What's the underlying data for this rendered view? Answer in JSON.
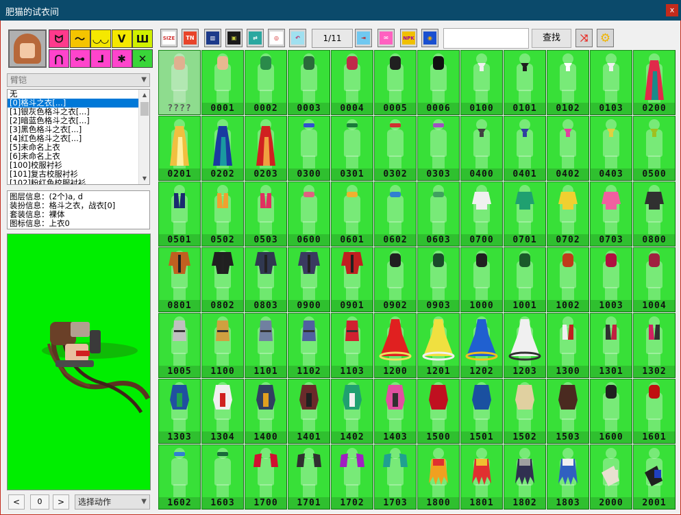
{
  "window": {
    "title": "肥猫的试衣间",
    "close": "x"
  },
  "categories": [
    {
      "icon": "cat-face-icon",
      "glyph": "ᗢ",
      "color": "#ff3a8c"
    },
    {
      "icon": "headband-icon",
      "glyph": "〜",
      "color": "#f5c400"
    },
    {
      "icon": "goggles-icon",
      "glyph": "◡◡",
      "color": "#f5e800"
    },
    {
      "icon": "wings-icon",
      "glyph": "ᐯ",
      "color": "#f5e800"
    },
    {
      "icon": "armor-icon",
      "glyph": "Ш",
      "color": "#d0f000"
    },
    {
      "icon": "pants-icon",
      "glyph": "⋂",
      "color": "#ff44cc"
    },
    {
      "icon": "belt-icon",
      "glyph": "⊶",
      "color": "#ff44cc"
    },
    {
      "icon": "boots-icon",
      "glyph": "⅃",
      "color": "#ff44cc"
    },
    {
      "icon": "figure-icon",
      "glyph": "✱",
      "color": "#ff44cc"
    },
    {
      "icon": "weapon-icon",
      "glyph": "✕",
      "color": "#39d639"
    }
  ],
  "slot_select": "臂铠",
  "list": [
    "无",
    "[0]格斗之衣[...]",
    "[1]银灰色格斗之衣[...]",
    "[2]暗蓝色格斗之衣[...]",
    "[3]黑色格斗之衣[...]",
    "[4]红色格斗之衣[...]",
    "[5]未命名上衣",
    "[6]未命名上衣",
    "[100]校服衬衫",
    "[101]复古校服衬衫",
    "[102]粉红色校服衬衫"
  ],
  "selected_index": 1,
  "info": {
    "layer": "图层信息：(2个)a, d",
    "outfit": "装扮信息：格斗之衣，战衣[0]",
    "set": "套装信息：裸体",
    "icon": "图标信息：上衣0"
  },
  "preview_nav": {
    "prev": "<",
    "frame": "0",
    "next": ">",
    "action_select": "选择动作"
  },
  "toolbar": {
    "tools": [
      {
        "name": "size-tool-icon",
        "text": "SIZE",
        "bg": "#ffffff",
        "fg": "#d03030"
      },
      {
        "name": "tn-tool-icon",
        "text": "TN",
        "bg": "#e8442a",
        "fg": "#ffffff"
      },
      {
        "name": "book-tool-icon",
        "text": "▥",
        "bg": "#1c3a8a",
        "fg": "#ffffff"
      },
      {
        "name": "frame-tool-icon",
        "text": "▣",
        "bg": "#1a1a1a",
        "fg": "#c8d040"
      },
      {
        "name": "shirt-swap-icon",
        "text": "⇄",
        "bg": "#2aa8a0",
        "fg": "#ffffff"
      },
      {
        "name": "target-tool-icon",
        "text": "◎",
        "bg": "#ffffff",
        "fg": "#d02020"
      },
      {
        "name": "undo-tool-icon",
        "text": "↶",
        "bg": "#a0e0f0",
        "fg": "#c02060"
      },
      {
        "name": "export-tool-icon",
        "text": "⇥",
        "bg": "#70c8f0",
        "fg": "#c02020"
      },
      {
        "name": "gift-tool-icon",
        "text": "✉",
        "bg": "#ff60c0",
        "fg": "#ffffff"
      },
      {
        "name": "npk-tool-icon",
        "text": "NPK",
        "bg": "#f0c000",
        "fg": "#a000a0"
      },
      {
        "name": "globe-tool-icon",
        "text": "◉",
        "bg": "#1a50d0",
        "fg": "#f0b000"
      }
    ],
    "page": "1/11",
    "search_value": "",
    "find_label": "查找",
    "shuffle_icon": "shuffle-icon",
    "settings_icon": "gear-icon",
    "colors": {
      "shuffle": "#e8302a",
      "gear": "#f0b400"
    }
  },
  "items": [
    {
      "code": "????",
      "dim": true,
      "colors": [
        "#e0b090"
      ],
      "kind": "top"
    },
    {
      "code": "0001",
      "colors": [
        "#e8b890"
      ],
      "kind": "top"
    },
    {
      "code": "0002",
      "colors": [
        "#2a8a4a"
      ],
      "kind": "top"
    },
    {
      "code": "0003",
      "colors": [
        "#2a6a3a"
      ],
      "kind": "top"
    },
    {
      "code": "0004",
      "colors": [
        "#c02a4a"
      ],
      "kind": "top"
    },
    {
      "code": "0005",
      "colors": [
        "#202020"
      ],
      "kind": "top"
    },
    {
      "code": "0006",
      "colors": [
        "#101010"
      ],
      "kind": "top"
    },
    {
      "code": "0100",
      "colors": [
        "#f0f0f0"
      ],
      "kind": "tie"
    },
    {
      "code": "0101",
      "colors": [
        "#202020"
      ],
      "kind": "tie"
    },
    {
      "code": "0102",
      "colors": [
        "#ffffff"
      ],
      "kind": "tie"
    },
    {
      "code": "0103",
      "colors": [
        "#f0f0f0"
      ],
      "kind": "tie"
    },
    {
      "code": "0200",
      "colors": [
        "#e02a4a",
        "#1a8a8a"
      ],
      "kind": "dress"
    },
    {
      "code": "0201",
      "colors": [
        "#f0c040",
        "#fff0a0"
      ],
      "kind": "dress"
    },
    {
      "code": "0202",
      "colors": [
        "#1a3aa0",
        "#1a9aa0"
      ],
      "kind": "dress"
    },
    {
      "code": "0203",
      "colors": [
        "#d02020",
        "#f0a040"
      ],
      "kind": "dress"
    },
    {
      "code": "0300",
      "colors": [
        "#3050d0"
      ],
      "kind": "band"
    },
    {
      "code": "0301",
      "colors": [
        "#1a7a3a"
      ],
      "kind": "band"
    },
    {
      "code": "0302",
      "colors": [
        "#d03030"
      ],
      "kind": "band"
    },
    {
      "code": "0303",
      "colors": [
        "#a050c0"
      ],
      "kind": "band"
    },
    {
      "code": "0400",
      "colors": [
        "#404040"
      ],
      "kind": "tie"
    },
    {
      "code": "0401",
      "colors": [
        "#3040a0"
      ],
      "kind": "tie"
    },
    {
      "code": "0402",
      "colors": [
        "#e040a0"
      ],
      "kind": "tie"
    },
    {
      "code": "0403",
      "colors": [
        "#e0d040"
      ],
      "kind": "tie"
    },
    {
      "code": "0500",
      "colors": [
        "#a0c020"
      ],
      "kind": "tie"
    },
    {
      "code": "0501",
      "colors": [
        "#1a2a70"
      ],
      "kind": "vest"
    },
    {
      "code": "0502",
      "colors": [
        "#f0a030"
      ],
      "kind": "vest"
    },
    {
      "code": "0503",
      "colors": [
        "#e03060"
      ],
      "kind": "vest"
    },
    {
      "code": "0600",
      "colors": [
        "#e06080"
      ],
      "kind": "bra"
    },
    {
      "code": "0601",
      "colors": [
        "#f0b030"
      ],
      "kind": "bra"
    },
    {
      "code": "0602",
      "colors": [
        "#3080d0"
      ],
      "kind": "bra"
    },
    {
      "code": "0603",
      "colors": [
        "#40a060"
      ],
      "kind": "bra"
    },
    {
      "code": "0700",
      "colors": [
        "#f0f0f0"
      ],
      "kind": "shirt"
    },
    {
      "code": "0701",
      "colors": [
        "#20a070"
      ],
      "kind": "shirt"
    },
    {
      "code": "0702",
      "colors": [
        "#f0d030"
      ],
      "kind": "shirt"
    },
    {
      "code": "0703",
      "colors": [
        "#f060a0"
      ],
      "kind": "shirt"
    },
    {
      "code": "0800",
      "colors": [
        "#303030"
      ],
      "kind": "shirt"
    },
    {
      "code": "0801",
      "colors": [
        "#c06020"
      ],
      "kind": "jacket"
    },
    {
      "code": "0802",
      "colors": [
        "#202020"
      ],
      "kind": "jacket"
    },
    {
      "code": "0803",
      "colors": [
        "#303850"
      ],
      "kind": "jacket"
    },
    {
      "code": "0900",
      "colors": [
        "#3a3a60"
      ],
      "kind": "jacket"
    },
    {
      "code": "0901",
      "colors": [
        "#c02020"
      ],
      "kind": "jacket"
    },
    {
      "code": "0902",
      "colors": [
        "#202020"
      ],
      "kind": "top"
    },
    {
      "code": "0903",
      "colors": [
        "#1a4a2a"
      ],
      "kind": "top"
    },
    {
      "code": "1000",
      "colors": [
        "#202020"
      ],
      "kind": "top"
    },
    {
      "code": "1001",
      "colors": [
        "#1a5a2a"
      ],
      "kind": "top"
    },
    {
      "code": "1002",
      "colors": [
        "#c03a1a"
      ],
      "kind": "top"
    },
    {
      "code": "1003",
      "colors": [
        "#b01040"
      ],
      "kind": "top"
    },
    {
      "code": "1004",
      "colors": [
        "#a02040"
      ],
      "kind": "top"
    },
    {
      "code": "1005",
      "colors": [
        "#c0c0c0"
      ],
      "kind": "tunic"
    },
    {
      "code": "1100",
      "colors": [
        "#d0a040"
      ],
      "kind": "tunic"
    },
    {
      "code": "1101",
      "colors": [
        "#7080a0"
      ],
      "kind": "tunic"
    },
    {
      "code": "1102",
      "colors": [
        "#5060a0"
      ],
      "kind": "tunic"
    },
    {
      "code": "1103",
      "colors": [
        "#d02030"
      ],
      "kind": "tunic"
    },
    {
      "code": "1200",
      "colors": [
        "#e02020",
        "#f0e060"
      ],
      "kind": "gown"
    },
    {
      "code": "1201",
      "colors": [
        "#f0e040",
        "#f0f0f0"
      ],
      "kind": "gown"
    },
    {
      "code": "1202",
      "colors": [
        "#2060d0",
        "#f0c020"
      ],
      "kind": "gown"
    },
    {
      "code": "1203",
      "colors": [
        "#f0f0f0",
        "#303030"
      ],
      "kind": "gown"
    },
    {
      "code": "1300",
      "colors": [
        "#f0f0f0",
        "#c02020"
      ],
      "kind": "vest"
    },
    {
      "code": "1301",
      "colors": [
        "#303030",
        "#c02040"
      ],
      "kind": "vest"
    },
    {
      "code": "1302",
      "colors": [
        "#d02060",
        "#303030"
      ],
      "kind": "vest"
    },
    {
      "code": "1303",
      "colors": [
        "#2050a0",
        "#20a050"
      ],
      "kind": "coat"
    },
    {
      "code": "1304",
      "colors": [
        "#f0f0f0",
        "#d02020"
      ],
      "kind": "coat"
    },
    {
      "code": "1400",
      "colors": [
        "#304060",
        "#e0a020"
      ],
      "kind": "coat"
    },
    {
      "code": "1401",
      "colors": [
        "#6a2a2a",
        "#202020"
      ],
      "kind": "coat"
    },
    {
      "code": "1402",
      "colors": [
        "#20a070",
        "#f0f0f0"
      ],
      "kind": "coat"
    },
    {
      "code": "1403",
      "colors": [
        "#e050a0",
        "#303030"
      ],
      "kind": "coat"
    },
    {
      "code": "1500",
      "colors": [
        "#c01020"
      ],
      "kind": "coat"
    },
    {
      "code": "1501",
      "colors": [
        "#1a50a0"
      ],
      "kind": "coat"
    },
    {
      "code": "1502",
      "colors": [
        "#e0d0a0"
      ],
      "kind": "coat"
    },
    {
      "code": "1503",
      "colors": [
        "#4a2a20"
      ],
      "kind": "coat"
    },
    {
      "code": "1600",
      "colors": [
        "#202020"
      ],
      "kind": "top"
    },
    {
      "code": "1601",
      "colors": [
        "#c01010"
      ],
      "kind": "top"
    },
    {
      "code": "1602",
      "colors": [
        "#3080d0"
      ],
      "kind": "band"
    },
    {
      "code": "1603",
      "colors": [
        "#1a6a3a"
      ],
      "kind": "band"
    },
    {
      "code": "1700",
      "colors": [
        "#d01030"
      ],
      "kind": "sleeves"
    },
    {
      "code": "1701",
      "colors": [
        "#303030"
      ],
      "kind": "sleeves"
    },
    {
      "code": "1702",
      "colors": [
        "#a020c0"
      ],
      "kind": "sleeves"
    },
    {
      "code": "1703",
      "colors": [
        "#20a090"
      ],
      "kind": "sleeves"
    },
    {
      "code": "1800",
      "colors": [
        "#f0a020",
        "#e03030"
      ],
      "kind": "fringe"
    },
    {
      "code": "1801",
      "colors": [
        "#e03030",
        "#f0c030"
      ],
      "kind": "fringe"
    },
    {
      "code": "1802",
      "colors": [
        "#303050",
        "#a0a0a0"
      ],
      "kind": "fringe"
    },
    {
      "code": "1803",
      "colors": [
        "#3060c0",
        "#f0f0f0"
      ],
      "kind": "fringe"
    },
    {
      "code": "2000",
      "colors": [
        "#e8e0d0"
      ],
      "kind": "scrap"
    },
    {
      "code": "2001",
      "colors": [
        "#202020",
        "#2040c0"
      ],
      "kind": "scrap"
    }
  ]
}
